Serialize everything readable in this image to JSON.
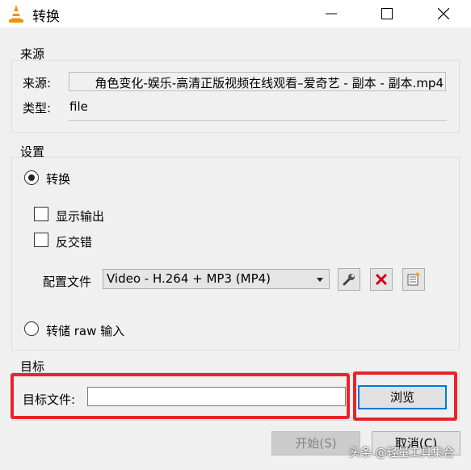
{
  "window": {
    "title": "转换",
    "icon": "vlc-cone-icon"
  },
  "source": {
    "group_title": "来源",
    "source_label": "来源:",
    "source_value": "角色变化-娱乐-高清正版视频在线观看–爱奇艺 - 副本 - 副本.mp4",
    "type_label": "类型:",
    "type_value": "file"
  },
  "settings": {
    "group_title": "设置",
    "convert_label": "转换",
    "convert_selected": true,
    "show_output_label": "显示输出",
    "deinterlace_label": "反交错",
    "profile_label": "配置文件",
    "profile_selected": "Video - H.264 + MP3 (MP4)",
    "dump_raw_label": "转储 raw 输入"
  },
  "destination": {
    "group_title": "目标",
    "file_label": "目标文件:",
    "file_value": "",
    "browse_label": "浏览"
  },
  "footer": {
    "start_label": "开始(S)",
    "cancel_label": "取消(C)"
  },
  "watermark": "头条 @轻量工具集合",
  "colors": {
    "highlight": "#e8242a",
    "focus_blue": "#0078d7",
    "delete_red": "#d0021b"
  }
}
